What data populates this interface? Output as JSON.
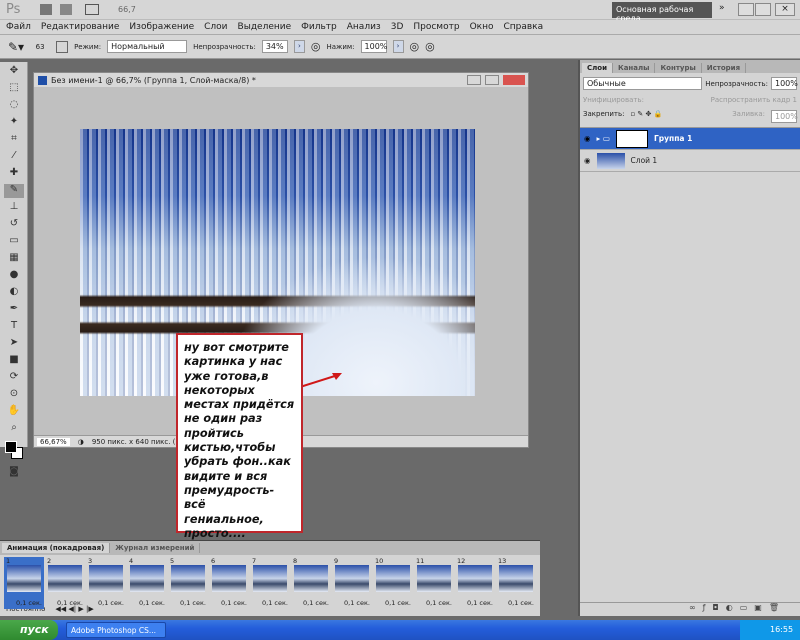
{
  "appbar": {
    "logo": "Ps",
    "zoom": "66,7",
    "workspace": "Основная рабочая среда"
  },
  "menu": [
    "Файл",
    "Редактирование",
    "Изображение",
    "Слои",
    "Выделение",
    "Фильтр",
    "Анализ",
    "3D",
    "Просмотр",
    "Окно",
    "Справка"
  ],
  "options": {
    "brush_size": "63",
    "mode_label": "Режим:",
    "mode_value": "Нормальный",
    "opacity_label": "Непрозрачность:",
    "opacity_value": "34%",
    "flow_label": "Нажим:",
    "flow_value": "100%"
  },
  "document": {
    "title": "Без имени-1 @ 66,7% (Группа 1, Слой-маска/8) *",
    "zoom": "66,67%",
    "info": "950 пикс. x 640 пикс. (72 ppi)"
  },
  "callout": "ну вот смотрите\nкартинка у нас\nуже готова,в\nнекоторых\nместах придётся\nне один раз\nпройтись\nкистью,чтобы\nубрать фон..как\nвидите и вся\nпремудрость-всё\nгениальное,\nпросто....",
  "layers_panel": {
    "tabs": [
      "Слои",
      "Каналы",
      "Контуры",
      "История"
    ],
    "blend": "Обычные",
    "opacity_label": "Непрозрачность:",
    "opacity": "100%",
    "unify_label": "Унифицировать:",
    "propagate": "Распространить кадр 1",
    "lock_label": "Закрепить:",
    "fill_label": "Заливка:",
    "fill": "100%",
    "layers": [
      {
        "name": "Группа 1",
        "selected": true
      },
      {
        "name": "Слой 1",
        "selected": false
      }
    ]
  },
  "animation": {
    "tabs": [
      "Анимация (покадровая)",
      "Журнал измерений"
    ],
    "frames": [
      {
        "n": "1",
        "d": "0,1 сек."
      },
      {
        "n": "2",
        "d": "0,1 сек."
      },
      {
        "n": "3",
        "d": "0,1 сек."
      },
      {
        "n": "4",
        "d": "0,1 сек."
      },
      {
        "n": "5",
        "d": "0,1 сек."
      },
      {
        "n": "6",
        "d": "0,1 сек."
      },
      {
        "n": "7",
        "d": "0,1 сек."
      },
      {
        "n": "8",
        "d": "0,1 сек."
      },
      {
        "n": "9",
        "d": "0,1 сек."
      },
      {
        "n": "10",
        "d": "0,1 сек."
      },
      {
        "n": "11",
        "d": "0,1 сек."
      },
      {
        "n": "12",
        "d": "0,1 сек."
      },
      {
        "n": "13",
        "d": "0,1 сек."
      }
    ],
    "loop": "Постоянно"
  },
  "taskbar": {
    "start": "пуск",
    "task": "Adobe Photoshop CS...",
    "clock": "16:55"
  },
  "colors": {
    "selection": "#2f63c4",
    "callout_border": "#c0262b",
    "taskbar": "#245edb"
  }
}
